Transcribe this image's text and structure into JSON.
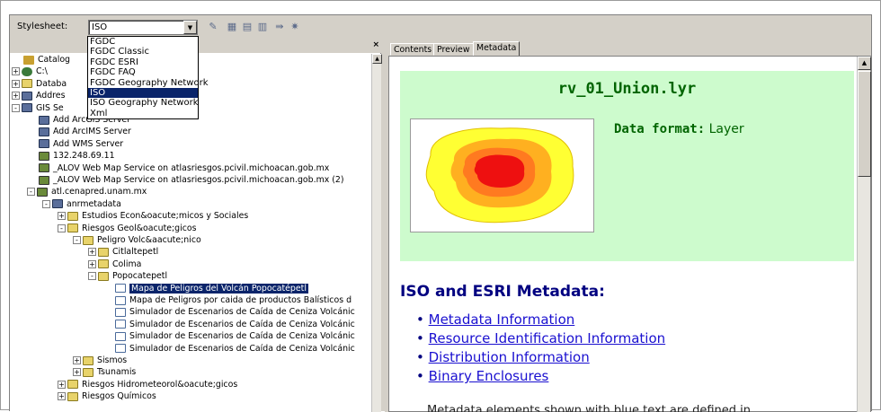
{
  "toolbar": {
    "stylesheet_label": "Stylesheet:",
    "stylesheet_value": "ISO"
  },
  "stylesheet_options": [
    "FGDC",
    "FGDC Classic",
    "FGDC ESRI",
    "FGDC FAQ",
    "FGDC Geography Network",
    "ISO",
    "ISO Geography Network",
    "Xml"
  ],
  "stylesheet_selected_index": 5,
  "tree": [
    {
      "indent": 0,
      "exp": "",
      "icon": "cat",
      "label": "Catalog"
    },
    {
      "indent": 0,
      "exp": "+",
      "icon": "db",
      "label": "C:\\"
    },
    {
      "indent": 0,
      "exp": "+",
      "icon": "folder",
      "label": "Databa"
    },
    {
      "indent": 0,
      "exp": "+",
      "icon": "srv",
      "label": "Addres"
    },
    {
      "indent": 0,
      "exp": "-",
      "icon": "srv",
      "label": "GIS Se"
    },
    {
      "indent": 1,
      "exp": "",
      "icon": "srv",
      "label": "Add ArcGIS Server"
    },
    {
      "indent": 1,
      "exp": "",
      "icon": "srv",
      "label": "Add ArcIMS Server"
    },
    {
      "indent": 1,
      "exp": "",
      "icon": "srv",
      "label": "Add WMS Server"
    },
    {
      "indent": 1,
      "exp": "",
      "icon": "net",
      "label": "132.248.69.11"
    },
    {
      "indent": 1,
      "exp": "",
      "icon": "net",
      "label": "_ALOV Web Map Service         on atlasriesgos.pcivil.michoacan.gob.mx"
    },
    {
      "indent": 1,
      "exp": "",
      "icon": "net",
      "label": "_ALOV Web Map Service         on atlasriesgos.pcivil.michoacan.gob.mx (2)"
    },
    {
      "indent": 1,
      "exp": "-",
      "icon": "net",
      "label": "atl.cenapred.unam.mx"
    },
    {
      "indent": 2,
      "exp": "-",
      "icon": "srv",
      "label": "anrmetadata"
    },
    {
      "indent": 3,
      "exp": "+",
      "icon": "folder",
      "label": "Estudios Econ&oacute;micos y Sociales"
    },
    {
      "indent": 3,
      "exp": "-",
      "icon": "folder",
      "label": "Riesgos Geol&oacute;gicos"
    },
    {
      "indent": 4,
      "exp": "-",
      "icon": "folder",
      "label": "Peligro Volc&aacute;nico"
    },
    {
      "indent": 5,
      "exp": "+",
      "icon": "folder",
      "label": "Citlaltepetl"
    },
    {
      "indent": 5,
      "exp": "+",
      "icon": "folder",
      "label": "Colima"
    },
    {
      "indent": 5,
      "exp": "-",
      "icon": "folder",
      "label": "Popocatepetl"
    },
    {
      "indent": 6,
      "exp": "",
      "icon": "doc",
      "label": "Mapa de Peligros del Volcán Popocatépetl",
      "hl": true
    },
    {
      "indent": 6,
      "exp": "",
      "icon": "doc",
      "label": "Mapa de Peligros por caida de productos Balísticos d"
    },
    {
      "indent": 6,
      "exp": "",
      "icon": "doc",
      "label": "Simulador de Escenarios de Caída de Ceniza Volcánic"
    },
    {
      "indent": 6,
      "exp": "",
      "icon": "doc",
      "label": "Simulador de Escenarios de Caída de Ceniza Volcánic"
    },
    {
      "indent": 6,
      "exp": "",
      "icon": "doc",
      "label": "Simulador de Escenarios de Caída de Ceniza Volcánic"
    },
    {
      "indent": 6,
      "exp": "",
      "icon": "doc",
      "label": "Simulador de Escenarios de Caída de Ceniza Volcánic"
    },
    {
      "indent": 4,
      "exp": "+",
      "icon": "folder",
      "label": "Sismos"
    },
    {
      "indent": 4,
      "exp": "+",
      "icon": "folder",
      "label": "Tsunamis"
    },
    {
      "indent": 3,
      "exp": "+",
      "icon": "folder",
      "label": "Riesgos Hidrometeorol&oacute;gicos"
    },
    {
      "indent": 3,
      "exp": "+",
      "icon": "folder",
      "label": "Riesgos Químicos"
    }
  ],
  "tabs": [
    "Contents",
    "Preview",
    "Metadata"
  ],
  "metadata": {
    "title": "rv_01_Union.lyr",
    "data_format_label": "Data format:",
    "data_format_value": "Layer",
    "section_heading": "ISO and ESRI Metadata:",
    "links": [
      "Metadata Information",
      "Resource Identification Information",
      "Distribution Information",
      "Binary Enclosures"
    ],
    "tail": "Metadata elements shown with blue text are defined in"
  }
}
